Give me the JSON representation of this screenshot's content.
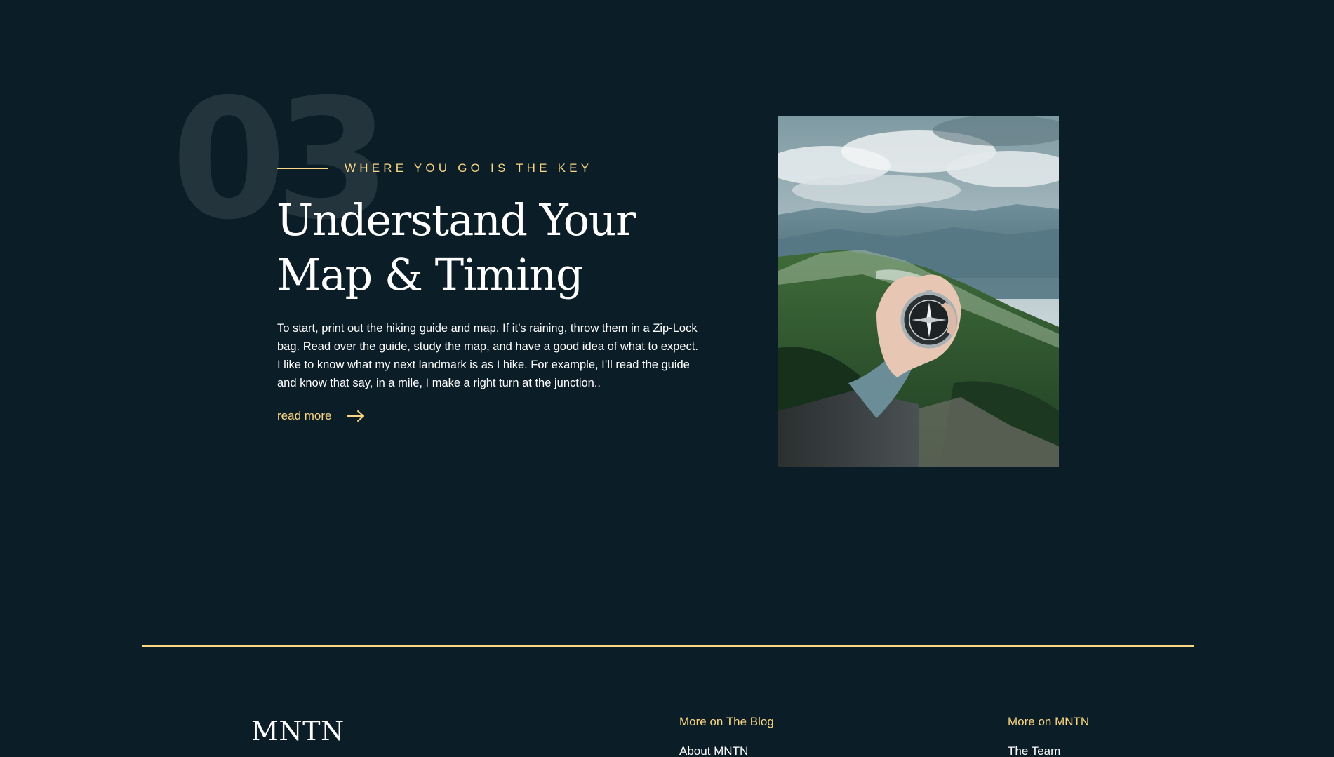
{
  "section": {
    "number": "03",
    "eyebrow": "WHERE YOU GO IS THE KEY",
    "headline_line1": "Understand Your",
    "headline_line2": "Map & Timing",
    "body": "To start, print out the hiking guide and map. If it’s raining, throw them in a Zip-Lock bag. Read over the guide, study the map, and have a good idea of what to expect. I like to know what my next landmark is as I hike. For example, I’ll read the guide and know that say, in a mile, I make a right turn at the junction..",
    "read_more_label": "read more",
    "read_more_icon": "arrow-right-icon",
    "image_subject": "hand-holding-compass-mountain-photo"
  },
  "footer": {
    "logo": "MNTN",
    "columns": [
      {
        "title": "More on The Blog",
        "links": [
          "About MNTN"
        ]
      },
      {
        "title": "More on MNTN",
        "links": [
          "The Team"
        ]
      }
    ]
  },
  "colors": {
    "background": "#0b1d26",
    "accent": "#fbd784",
    "text": "#ffffff"
  }
}
